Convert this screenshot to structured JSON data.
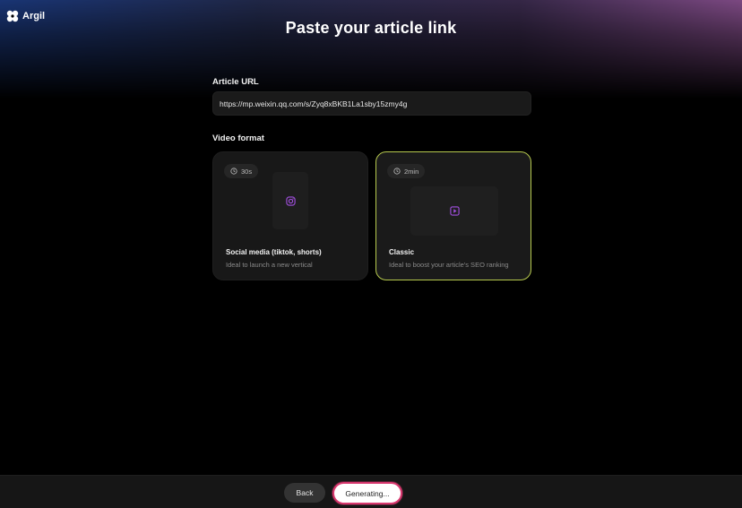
{
  "app": {
    "name": "Argil"
  },
  "page": {
    "title": "Paste your article link"
  },
  "article_url": {
    "label": "Article URL",
    "value": "https://mp.weixin.qq.com/s/Zyq8xBKB1La1sby15zmy4g"
  },
  "video_format": {
    "label": "Video format",
    "options": [
      {
        "duration": "30s",
        "title": "Social media (tiktok, shorts)",
        "description": "Ideal to launch a new vertical",
        "icon": "instagram-icon",
        "selected": false
      },
      {
        "duration": "2min",
        "title": "Classic",
        "description": "Ideal to boost your article's SEO ranking",
        "icon": "video-play-icon",
        "selected": true
      }
    ]
  },
  "footer": {
    "back_label": "Back",
    "generate_label": "Generating..."
  },
  "colors": {
    "selected_border": "#b6c94e",
    "icon_purple": "#a24fe0",
    "generate_border": "#d9386f"
  }
}
